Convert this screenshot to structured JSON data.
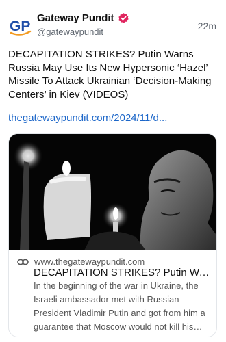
{
  "post": {
    "author": {
      "name": "Gateway Pundit",
      "handle": "@gatewaypundit",
      "avatar_text": "GP",
      "verified": true
    },
    "timestamp": "22m",
    "text": "DECAPITATION STRIKES? Putin Warns Russia May Use Its New Hypersonic ‘Hazel’ Missile To Attack Ukrainian ‘Decision-Making Centers’ in Kiev (VIDEOS)",
    "link_text": "thegatewaypundit.com/2024/11/d..."
  },
  "link_card": {
    "domain": "www.thegatewaypundit.com",
    "title": "DECAPITATION STRIKES? Putin Warn...",
    "description": "In the beginning of the war in Ukraine, the Israeli ambassador met with Russian President Vladimir Putin and got from him a guarantee that Moscow would not kill his Uk..."
  },
  "colors": {
    "brand_blue": "#1f4ea8",
    "brand_orange": "#f29a1f",
    "verified": "#e0245e",
    "link": "#1d67c9",
    "muted": "#606770"
  },
  "icons": {
    "verified": "verified-badge-icon",
    "link": "link-icon"
  }
}
